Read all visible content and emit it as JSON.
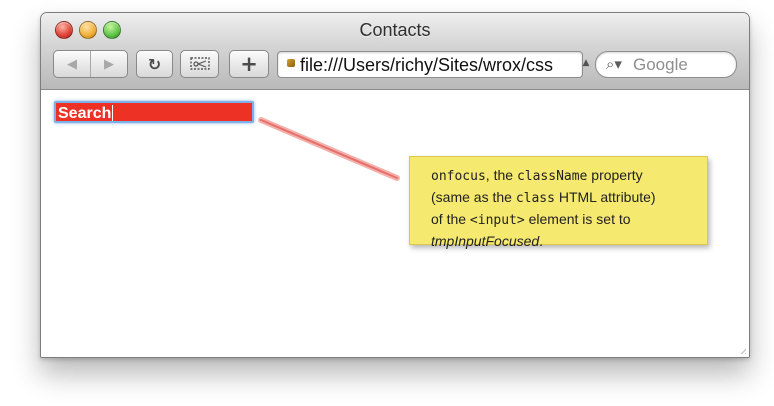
{
  "window": {
    "title": "Contacts"
  },
  "toolbar": {
    "back_icon": "back-icon",
    "forward_icon": "forward-icon",
    "reload_icon": "reload-icon",
    "snip_icon": "snip-icon",
    "add_label": "+",
    "address_url": "file:///Users/richy/Sites/wrox/css",
    "search_placeholder": "Google"
  },
  "content": {
    "search_value": "Search",
    "note": {
      "part_1": "onfocus",
      "part_2": ", the ",
      "part_3": "className",
      "part_4": " property",
      "line_2_a": "(same as the ",
      "line_2_b": "class",
      "line_2_c": " HTML attribute)",
      "line_3_a": "of the ",
      "line_3_b": "<input>",
      "line_3_c": " element is set to",
      "line_4_a": "tmpInputFocused",
      "line_4_b": "."
    }
  },
  "colors": {
    "focused_input_background": "#ed3125",
    "focus_ring": "#7db0e8",
    "note_background": "#f6e96f",
    "connector": "#e76f6b"
  }
}
